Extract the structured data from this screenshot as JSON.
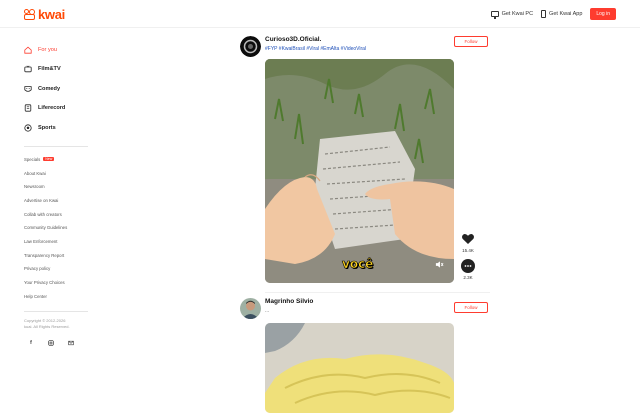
{
  "brand": {
    "name": "kwai",
    "color": "#ff4906"
  },
  "header": {
    "pc_label": "Get Kwai PC",
    "app_label": "Get Kwai App",
    "login_label": "Log in"
  },
  "nav": [
    {
      "label": "For you",
      "icon": "home-icon",
      "active": true
    },
    {
      "label": "Film&TV",
      "icon": "tv-icon",
      "active": false
    },
    {
      "label": "Comedy",
      "icon": "comedy-icon",
      "active": false
    },
    {
      "label": "Liferecord",
      "icon": "notebook-icon",
      "active": false
    },
    {
      "label": "Sports",
      "icon": "ball-icon",
      "active": false
    }
  ],
  "footer_links": {
    "specials": "Specials",
    "specials_badge": "New",
    "items": [
      "About Kwai",
      "Newsroom",
      "Advertise on Kwai",
      "Collab with creators",
      "Community Guidelines",
      "Law Enforcement",
      "Transparency Report",
      "Privacy policy",
      "Your Privacy Choices",
      "Help Center"
    ]
  },
  "copyright": {
    "line1": "Copyright © 2012-2026",
    "line2": "kuai. All Rights Reserved."
  },
  "socials": [
    "facebook-icon",
    "instagram-icon",
    "email-icon"
  ],
  "posts": [
    {
      "author": "Curioso3D.Oficial.",
      "caption": "#FYP #KwaiBrasil #Viral #EmAlta #VideoViral",
      "follow_label": "Follow",
      "subtitle": "você",
      "likes": "15.4K",
      "comments": "2.3K"
    },
    {
      "author": "Magrinho Silvio",
      "caption": "...",
      "follow_label": "Follow"
    }
  ]
}
